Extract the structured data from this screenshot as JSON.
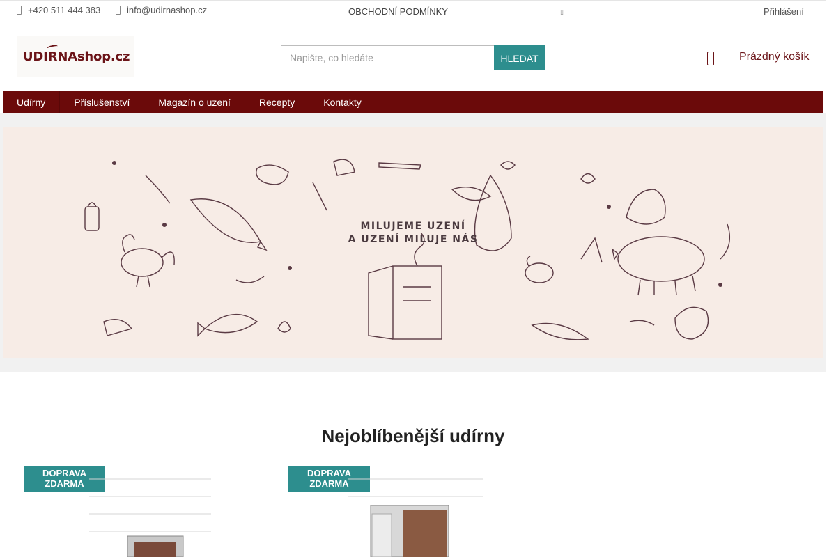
{
  "topbar": {
    "phone": "+420 511 444 383",
    "email": "info@udirnashop.cz",
    "terms": "OBCHODNÍ PODMÍNKY",
    "lang_icon": "",
    "login": "Přihlášení"
  },
  "header": {
    "logo_main": "UDIRNA",
    "logo_suffix": "shop.cz",
    "search_placeholder": "Napište, co hledáte",
    "search_button": "HLEDAT",
    "cart_icon": "cart-icon",
    "cart_text": "Prázdný košík"
  },
  "nav": {
    "items": [
      "Udírny",
      "Příslušenství",
      "Magazín o uzení",
      "Recepty",
      "Kontakty"
    ]
  },
  "hero": {
    "line1": "MILUJEME UZENÍ",
    "line2": "A UZENÍ MILUJE NÁS"
  },
  "products": {
    "title": "Nejoblíbenější udírny",
    "badges": [
      "DOPRAVA ZDARMA",
      "DOPRAVA ZDARMA"
    ]
  },
  "colors": {
    "brand": "#6b0a0a",
    "accent": "#2d8e8e",
    "hero_bg": "#f7ece6",
    "illustration": "#5a3a44"
  }
}
